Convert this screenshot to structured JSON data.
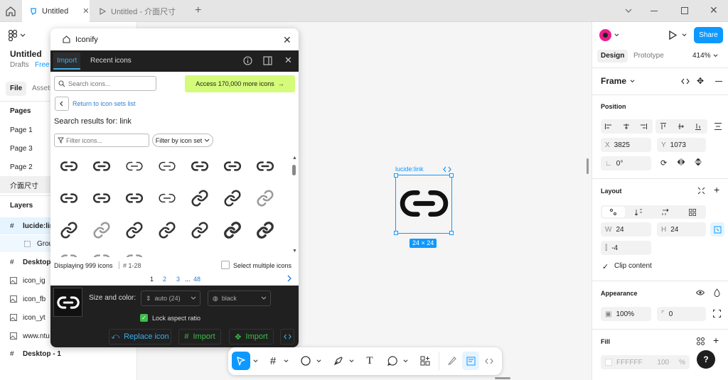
{
  "titlebar": {
    "tabs": [
      {
        "label": "Untitled"
      },
      {
        "label": "Untitled - 介面尺寸"
      }
    ]
  },
  "left": {
    "file_title": "Untitled",
    "drafts": "Drafts",
    "plan": "Free",
    "file_tab": "File",
    "assets_tab": "Assets",
    "pages_heading": "Pages",
    "pages": [
      "Page 1",
      "Page 3",
      "Page 2",
      "介面尺寸"
    ],
    "layers_heading": "Layers",
    "layers": [
      {
        "label": "lucide:link",
        "icon": "frame-hash-icon"
      },
      {
        "label": "Group",
        "icon": "group-icon"
      },
      {
        "label": "Desktop",
        "icon": "frame-hash-icon"
      },
      {
        "label": "icon_ig",
        "icon": "image-icon"
      },
      {
        "label": "icon_fb",
        "icon": "image-icon"
      },
      {
        "label": "icon_yt",
        "icon": "image-icon"
      },
      {
        "label": "www.ntu",
        "icon": "image-icon"
      },
      {
        "label": "Desktop - 1",
        "icon": "frame-hash-icon"
      }
    ]
  },
  "plugin": {
    "title": "Iconify",
    "tabs": {
      "import": "Import",
      "recent": "Recent icons"
    },
    "search_placeholder": "Search icons...",
    "access_button": "Access 170,000 more icons",
    "return_link": "Return to icon sets list",
    "results_title": "Search results for: link",
    "filter_placeholder": "Filter icons...",
    "filter_set": "Filter by icon set",
    "displaying": "Displaying 999 icons",
    "range": "# 1-28",
    "select_multiple": "Select multiple icons",
    "pages": [
      "1",
      "2",
      "3",
      "...",
      "48"
    ],
    "size_color_label": "Size and color:",
    "size_value": "auto (24)",
    "color_value": "black",
    "lock_aspect": "Lock aspect ratio",
    "replace_btn": "Replace icon",
    "import_btn1": "Import",
    "import_btn2": "Import",
    "accent_green": "#d4fb79",
    "accent_blue": "#3daee9"
  },
  "canvas": {
    "frame_label": "lucide:link",
    "size_badge": "24 × 24",
    "selection_color": "#0d99ff"
  },
  "right": {
    "share": "Share",
    "design_tab": "Design",
    "prototype_tab": "Prototype",
    "zoom": "414%",
    "frame_title": "Frame",
    "position_heading": "Position",
    "x_label": "X",
    "x_value": "3825",
    "y_label": "Y",
    "y_value": "1073",
    "rotation": "0°",
    "layout_heading": "Layout",
    "w_label": "W",
    "w_value": "24",
    "h_label": "H",
    "h_value": "24",
    "gap_value": "-4",
    "clip_content": "Clip content",
    "appearance_heading": "Appearance",
    "opacity": "100%",
    "radius": "0",
    "fill_heading": "Fill",
    "fill_hex": "FFFFFF",
    "fill_opacity": "100",
    "fill_pct": "%",
    "help": "?"
  }
}
